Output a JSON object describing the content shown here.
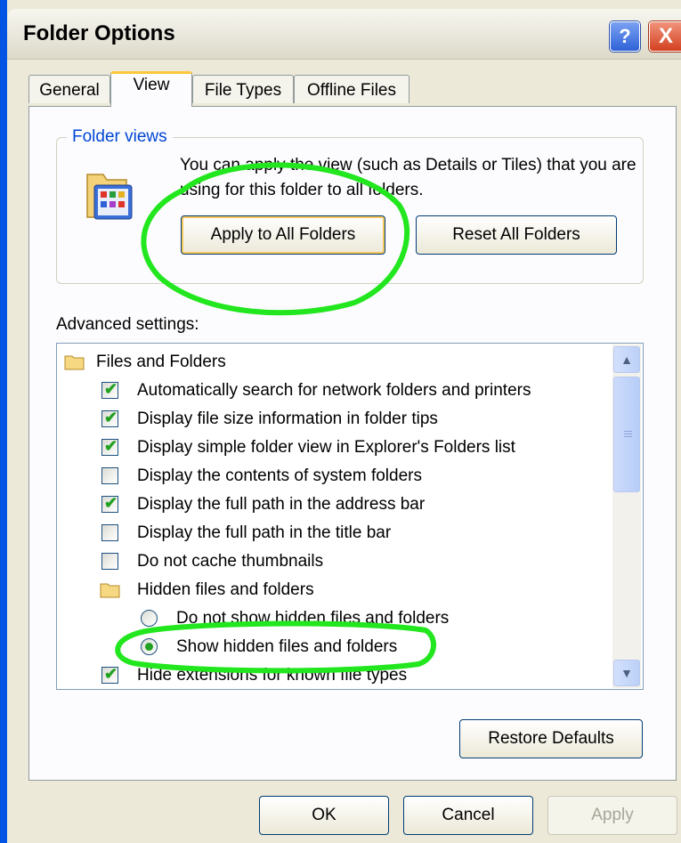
{
  "window": {
    "title": "Folder Options",
    "help_glyph": "?",
    "close_glyph": "X"
  },
  "tabs": [
    {
      "label": "General",
      "active": false
    },
    {
      "label": "View",
      "active": true
    },
    {
      "label": "File Types",
      "active": false
    },
    {
      "label": "Offline Files",
      "active": false
    }
  ],
  "folder_views": {
    "legend": "Folder views",
    "description": "You can apply the view (such as Details or Tiles) that you are using for this folder to all folders.",
    "apply_label": "Apply to All Folders",
    "reset_label": "Reset All Folders"
  },
  "advanced": {
    "label": "Advanced settings:",
    "items": [
      {
        "type": "folder",
        "label": "Files and Folders"
      },
      {
        "type": "checkbox",
        "label": "Automatically search for network folders and printers",
        "checked": true
      },
      {
        "type": "checkbox",
        "label": "Display file size information in folder tips",
        "checked": true
      },
      {
        "type": "checkbox",
        "label": "Display simple folder view in Explorer's Folders list",
        "checked": true
      },
      {
        "type": "checkbox",
        "label": "Display the contents of system folders",
        "checked": false
      },
      {
        "type": "checkbox",
        "label": "Display the full path in the address bar",
        "checked": true
      },
      {
        "type": "checkbox",
        "label": "Display the full path in the title bar",
        "checked": false
      },
      {
        "type": "checkbox",
        "label": "Do not cache thumbnails",
        "checked": false
      },
      {
        "type": "folder",
        "label": "Hidden files and folders"
      },
      {
        "type": "radio",
        "label": "Do not show hidden files and folders",
        "selected": false
      },
      {
        "type": "radio",
        "label": "Show hidden files and folders",
        "selected": true
      },
      {
        "type": "checkbox",
        "label": "Hide extensions for known file types",
        "checked": true
      }
    ],
    "restore_label": "Restore Defaults"
  },
  "footer": {
    "ok_label": "OK",
    "cancel_label": "Cancel",
    "apply_label": "Apply"
  },
  "colors": {
    "accent_tab": "#ffc83c",
    "check": "#21a121",
    "annotation": "#22e61e"
  }
}
